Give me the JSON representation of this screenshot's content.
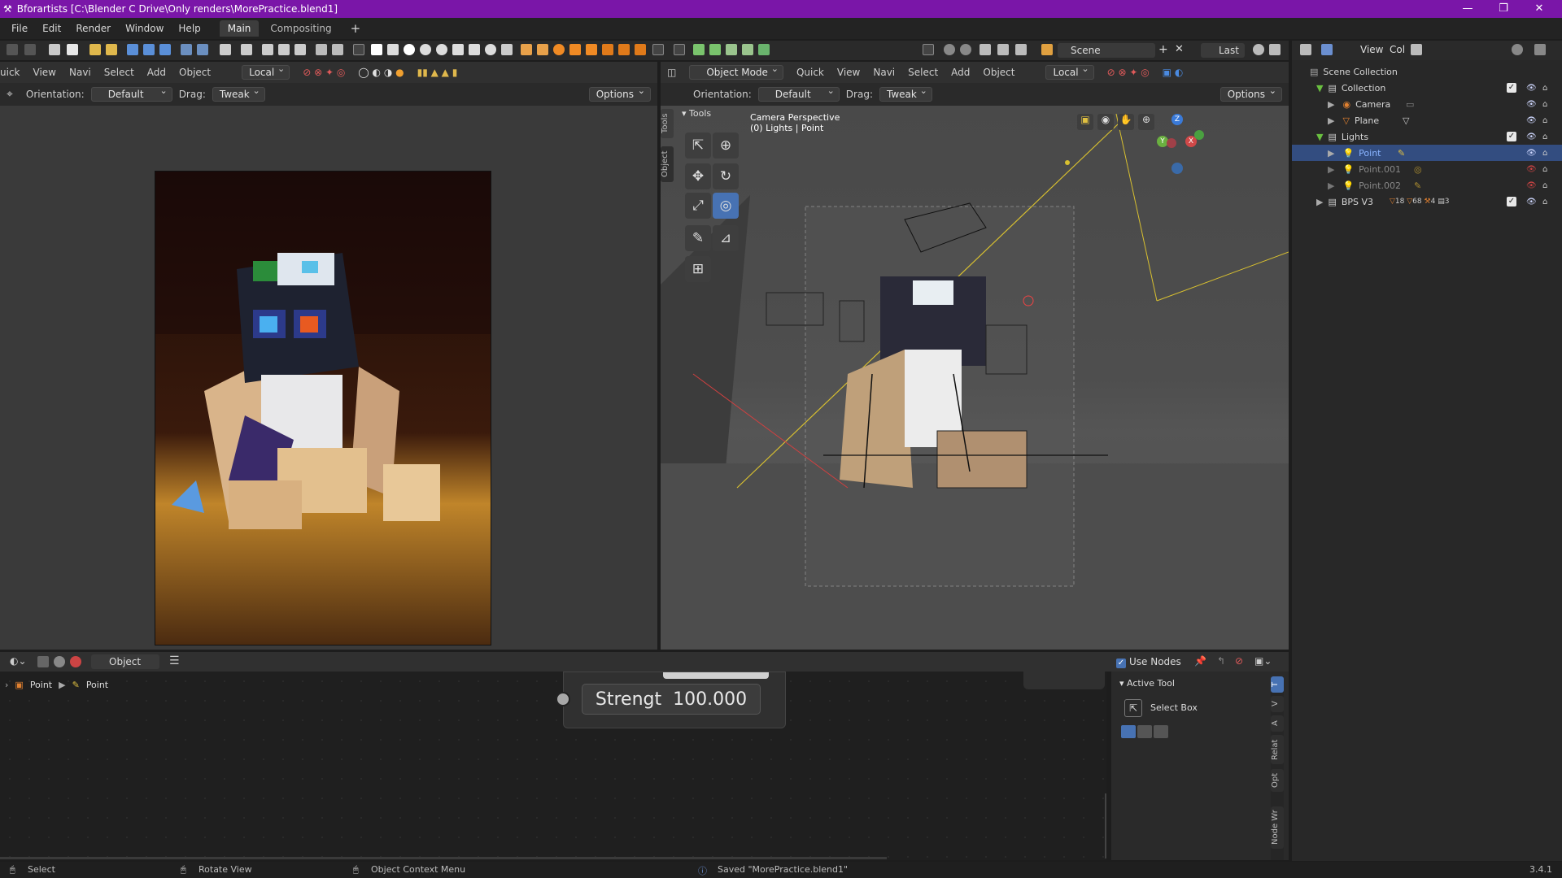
{
  "window": {
    "title": "Bforartists [C:\\Blender C Drive\\Only renders\\MorePractice.blend1]",
    "buttons": [
      "—",
      "❐",
      "✕"
    ]
  },
  "menu": {
    "items": [
      "File",
      "Edit",
      "Render",
      "Window",
      "Help"
    ],
    "tabs": [
      "Main",
      "Compositing"
    ],
    "add_tab": "+"
  },
  "left_viewport": {
    "menus": [
      "uick",
      "View",
      "Navi",
      "Select",
      "Add",
      "Object"
    ],
    "transform": "Local",
    "orientation_label": "Orientation:",
    "orientation_value": "Default",
    "drag_label": "Drag:",
    "drag_value": "Tweak",
    "options": "Options"
  },
  "right_viewport": {
    "mode": "Object Mode",
    "menus": [
      "Quick",
      "View",
      "Navi",
      "Select",
      "Add",
      "Object"
    ],
    "transform": "Local",
    "orientation_label": "Orientation:",
    "orientation_value": "Default",
    "drag_label": "Drag:",
    "drag_value": "Tweak",
    "options": "Options",
    "overlay_line1": "Camera Perspective",
    "overlay_line2": "(0) Lights | Point",
    "tools_header": "Tools",
    "side_tabs": [
      "Tools",
      "Object"
    ]
  },
  "top_right_header": {
    "scene": "Scene",
    "last": "Last",
    "view": "View",
    "col": "Col"
  },
  "outliner": {
    "rows": [
      {
        "label": "Scene Collection",
        "indent": 0
      },
      {
        "label": "Collection",
        "indent": 1
      },
      {
        "label": "Camera",
        "indent": 2
      },
      {
        "label": "Plane",
        "indent": 2
      },
      {
        "label": "Lights",
        "indent": 1
      },
      {
        "label": "Point",
        "indent": 2,
        "selected": true
      },
      {
        "label": "Point.001",
        "indent": 2
      },
      {
        "label": "Point.002",
        "indent": 2
      },
      {
        "label": "BPS V3",
        "indent": 1
      }
    ],
    "bps_counts": [
      "18",
      "68",
      "4",
      "3"
    ]
  },
  "node_editor": {
    "header_object": "Object",
    "use_nodes": "Use Nodes",
    "breadcrumb": [
      "Point",
      "Point"
    ],
    "node_field_label": "Strengt",
    "node_field_value": "100.000",
    "panel_title": "Active Tool",
    "tool_name": "Select Box",
    "side_tabs": [
      "T",
      "V",
      "A",
      "Relat",
      "Opt",
      "Node Wr"
    ]
  },
  "statusbar": {
    "select": "Select",
    "rotate": "Rotate View",
    "context": "Object Context Menu",
    "saved": "Saved \"MorePractice.blend1\"",
    "version": "3.4.1"
  },
  "colors": {
    "title_bar": "#7a16a8",
    "selection": "#334d80",
    "active_tool": "#4772b3"
  }
}
